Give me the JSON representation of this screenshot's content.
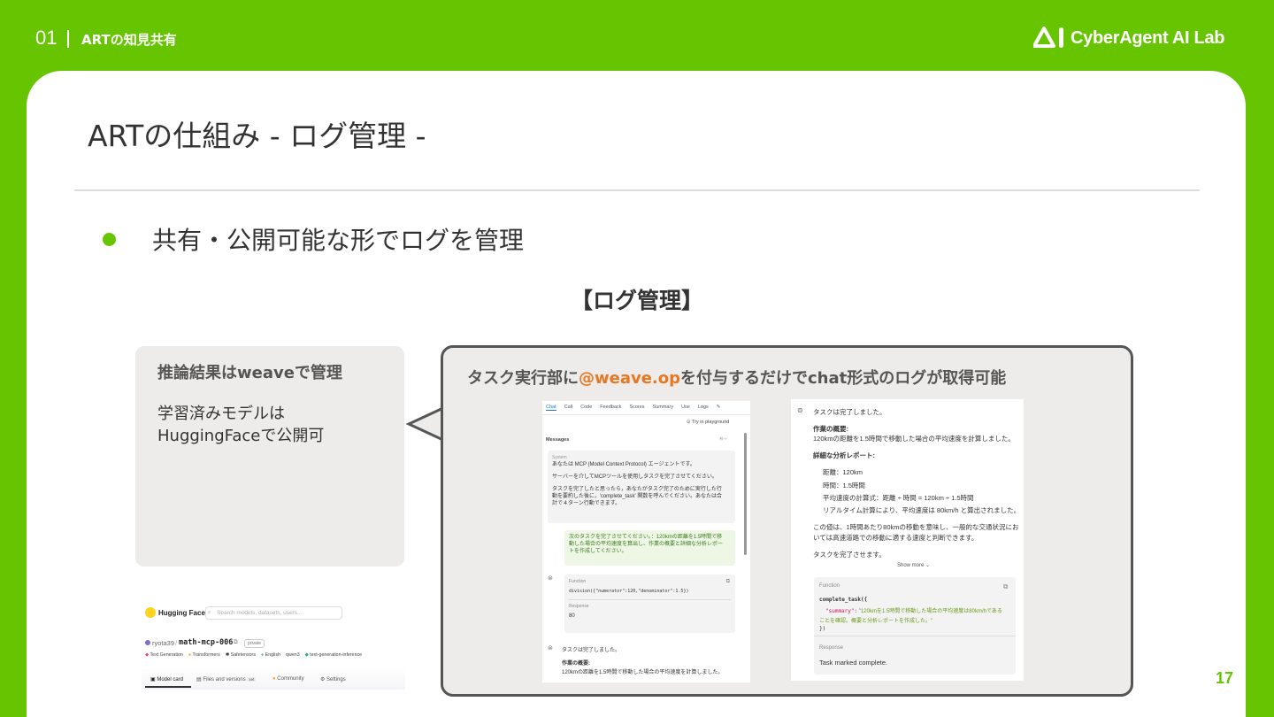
{
  "header": {
    "section_number": "01",
    "section_title": "ARTの知見共有",
    "logo_text": "CyberAgent AI Lab"
  },
  "slide": {
    "title": "ARTの仕組み - ログ管理 -",
    "bullet": "共有・公開可能な形でログを管理",
    "subheading": "【ログ管理】",
    "page_number": "17"
  },
  "left_box": {
    "title": "推論結果はweaveで管理",
    "body": "学習済みモデルは HuggingFaceで公開可"
  },
  "right_box": {
    "title_prefix": "タスク実行部に",
    "title_accent": "@weave.op",
    "title_suffix": "を付与するだけでchat形式のログが取得可能"
  },
  "hf": {
    "brand": "Hugging Face",
    "search_placeholder": "Search models, datasets, users...",
    "user": "ryota39",
    "repo": "math-mcp-006",
    "visibility": "private",
    "tags": [
      "Text Generation",
      "Transformers",
      "Safetensors",
      "English",
      "qwen3",
      "text-generation-inference"
    ],
    "tabs": [
      "Model card",
      "Files and versions",
      "Community",
      "Settings"
    ],
    "files_badge": "xet"
  },
  "weave_chat": {
    "tabs": [
      "Chat",
      "Call",
      "Code",
      "Feedback",
      "Scores",
      "Summary",
      "Use",
      "Logs"
    ],
    "playground": "Try in playground",
    "messages_label": "Messages",
    "system_label": "System",
    "system_lines": [
      "あなたは MCP (Model Context Protocol) エージェントです。",
      "サーバーを介してMCPツールを使用しタスクを完了させてください。",
      "タスクを完了したと思ったら，あなたがタスク完了のために実行した行",
      "動を要約した後に，'complete_task' 関数を呼んでください。あなたは合",
      "計で４ターン行動できます。"
    ],
    "user_lines": [
      "次のタスクを完了させてください。：120kmの距離を1.5時間で移",
      "動した場合の平均速度を算出し、作業の概要と詳細な分析レポー",
      "トを作成してください。"
    ],
    "function_label": "Function",
    "function_call": "division({\"numerator\":120,\"denominator\":1.5})",
    "response_label": "Response",
    "response_value": "80",
    "assistant_line": "タスクは完了しました。",
    "overview_label": "作業の概要:",
    "overview_text": "120kmの距離を1.5時間で移動した場合の平均速度を計算しました。"
  },
  "weave_detail": {
    "done": "タスクは完了しました。",
    "overview_label": "作業の概要:",
    "overview_text": "120kmの距離を1.5時間で移動した場合の平均速度を計算しました。",
    "report_label": "詳細な分析レポート:",
    "report_items": [
      "距離：120km",
      "時間：1.5時間",
      "平均速度の計算式：距離 ÷ 時間 = 120km ÷ 1.5時間",
      "リアルタイム計算により、平均速度は 80km/h と算出されました。"
    ],
    "note_lines": [
      "この値は、1時間あたり80kmの移動を意味し、一般的な交通状況にお",
      "いては高速道路での移動に適する速度と判断できます。"
    ],
    "complete_line": "タスクを完了させます。",
    "show_more": "Show more",
    "function_label": "Function",
    "code_line1": "complete_task({",
    "code_key": "\"summary\":",
    "code_val1": "\"120kmを1.5時間で移動した場合の平均速度は80km/hである",
    "code_val2": "ことを確認。概要と分析レポートを作成した。\"",
    "code_end": "})",
    "response_label": "Response",
    "response_value": "Task marked complete."
  },
  "colors": {
    "brand_green": "#66c500",
    "accent_orange": "#e87722"
  }
}
